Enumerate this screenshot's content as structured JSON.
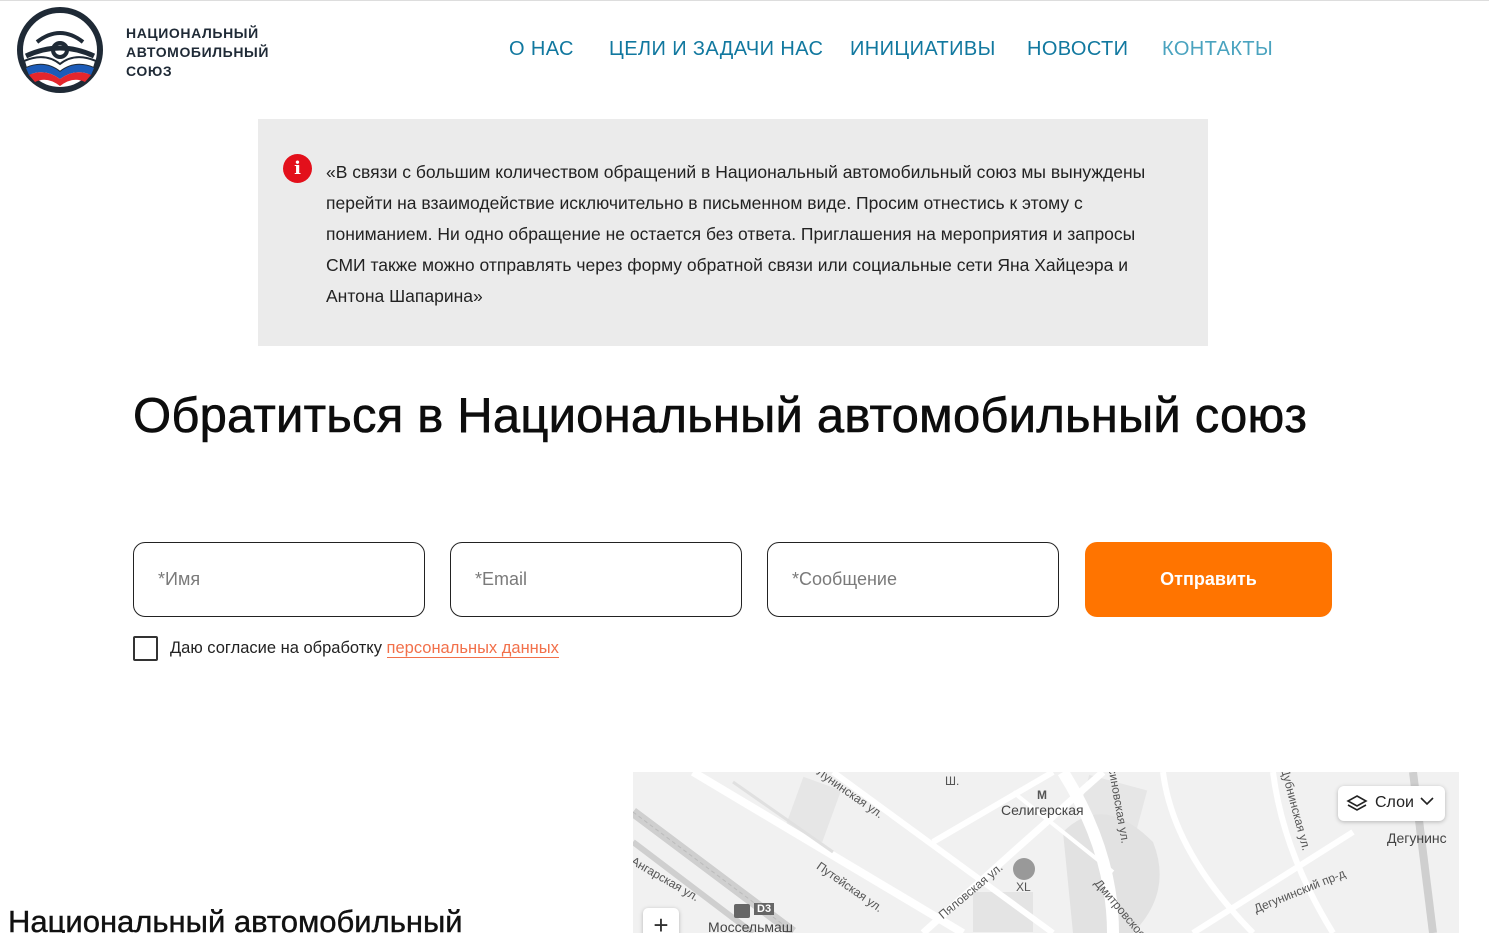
{
  "header": {
    "logo_lines": [
      "НАЦИОНАЛЬНЫЙ",
      "АВТОМОБИЛЬНЫЙ",
      "СОЮЗ"
    ],
    "nav": [
      {
        "label": "О НАС"
      },
      {
        "label": "ЦЕЛИ И ЗАДАЧИ НАС"
      },
      {
        "label": "ИНИЦИАТИВЫ"
      },
      {
        "label": "НОВОСТИ"
      },
      {
        "label": "КОНТАКТЫ",
        "active": true
      }
    ]
  },
  "notice": {
    "icon": "i",
    "text": "«В связи с большим количеством обращений в Национальный автомобильный союз мы вынуждены перейти на взаимодействие исключительно в письменном виде. Просим отнестись к этому с пониманием. Ни одно обращение не остается без ответа. Приглашения на мероприятия и запросы СМИ также можно отправлять через форму обратной связи или социальные сети Яна Хайцеэра и Антона Шапарина»"
  },
  "main": {
    "title": "Обратиться в Национальный автомобильный союз"
  },
  "form": {
    "name": {
      "placeholder": "*Имя",
      "value": ""
    },
    "email": {
      "placeholder": "*Email",
      "value": ""
    },
    "message": {
      "placeholder": "*Сообщение",
      "value": ""
    },
    "submit_label": "Отправить",
    "consent_text": "Даю согласие на обработку",
    "consent_link": "персональных данных",
    "consent_checked": false
  },
  "contacts": {
    "org_name": "Национальный автомобильный"
  },
  "map": {
    "layers_label": "Слои",
    "zoom_in": "+",
    "metro_1": "Селигерская",
    "metro_2": "Дегунинс",
    "station_1": "Моссельмаш",
    "store": "XL",
    "line_badge": "D3",
    "streets": [
      "Лунинская ул.",
      "Путейская ул.",
      "Пяловская ул.",
      "Ангарская ул.",
      "Дмитровское ш.",
      "Дегунинский пр-д",
      "Ш.",
      "Дубнинская ул.",
      "Бусиновская ул."
    ]
  },
  "colors": {
    "nav": "#11789f",
    "nav_active": "#4aa3bf",
    "accent": "#ff7400",
    "notice_bg": "#ebebeb",
    "alert": "#e3101b",
    "link": "#f2704a"
  }
}
